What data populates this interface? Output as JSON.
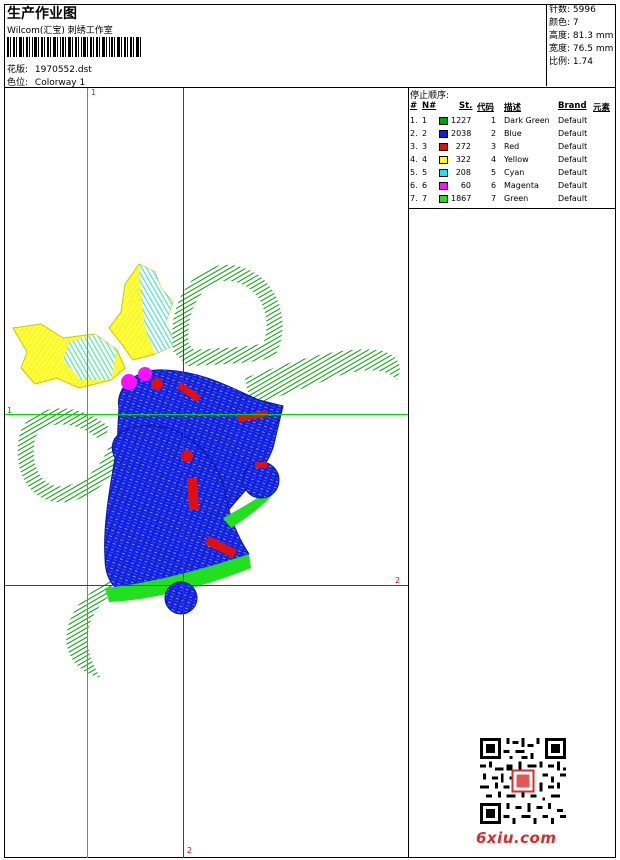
{
  "header": {
    "title": "生产作业图",
    "studio": "Wilcom(汇宝) 刺绣工作室",
    "design_label": "花版:",
    "design_file": "1970552.dst",
    "colorway_label": "色位:",
    "colorway": "Colorway 1"
  },
  "stats": [
    {
      "label": "针数:",
      "value": "5996"
    },
    {
      "label": "颜色:",
      "value": "7"
    },
    {
      "label": "高度:",
      "value": "81.3 mm"
    },
    {
      "label": "宽度:",
      "value": "76.5 mm"
    },
    {
      "label": "比例:",
      "value": "1.74"
    }
  ],
  "canvas": {
    "guide_labels": {
      "v1": "1",
      "h1": "1",
      "h2": "2",
      "v2": "2"
    },
    "colors": {
      "guide_green": "#00d800",
      "guide_red": "#e00000"
    }
  },
  "legend": {
    "title": "停止顺序:",
    "headers": {
      "num": "#",
      "no": "N#",
      "st": "St.",
      "code": "代码",
      "desc": "描述",
      "brand": "Brand",
      "elem": "元素"
    },
    "rows": [
      {
        "num": "1.",
        "no": "1",
        "color": "#00a000",
        "stitches": "1227",
        "code": "1",
        "desc": "Dark Green",
        "brand": "Default"
      },
      {
        "num": "2.",
        "no": "2",
        "color": "#1020e0",
        "stitches": "2038",
        "code": "2",
        "desc": "Blue",
        "brand": "Default"
      },
      {
        "num": "3.",
        "no": "3",
        "color": "#e01010",
        "stitches": "272",
        "code": "3",
        "desc": "Red",
        "brand": "Default"
      },
      {
        "num": "4.",
        "no": "4",
        "color": "#ffff00",
        "stitches": "322",
        "code": "4",
        "desc": "Yellow",
        "brand": "Default"
      },
      {
        "num": "5.",
        "no": "5",
        "color": "#20e0ff",
        "stitches": "208",
        "code": "5",
        "desc": "Cyan",
        "brand": "Default"
      },
      {
        "num": "6.",
        "no": "6",
        "color": "#ff10ff",
        "stitches": "60",
        "code": "6",
        "desc": "Magenta",
        "brand": "Default"
      },
      {
        "num": "7.",
        "no": "7",
        "color": "#20e020",
        "stitches": "1867",
        "code": "7",
        "desc": "Green",
        "brand": "Default"
      }
    ]
  },
  "watermark": {
    "logo_text": "6xiu.com"
  }
}
